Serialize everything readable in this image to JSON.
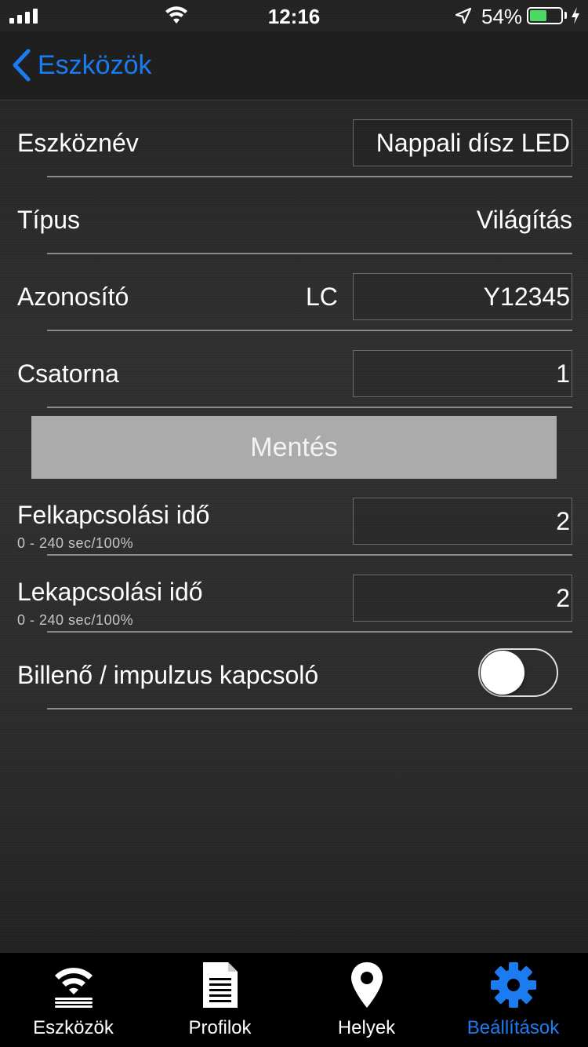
{
  "status_bar": {
    "time": "12:16",
    "battery_percent": "54%",
    "battery_level": 0.54
  },
  "nav": {
    "back_label": "Eszközök"
  },
  "form": {
    "device_name": {
      "label": "Eszköznév",
      "value": "Nappali dísz LED"
    },
    "type": {
      "label": "Típus",
      "value": "Világítás"
    },
    "identifier": {
      "label": "Azonosító",
      "prefix": "LC",
      "value": "Y12345"
    },
    "channel": {
      "label": "Csatorna",
      "value": "1"
    },
    "save_label": "Mentés",
    "ramp_up": {
      "label": "Felkapcsolási idő",
      "hint": "0 - 240 sec/100%",
      "value": "2"
    },
    "ramp_down": {
      "label": "Lekapcsolási idő",
      "hint": "0 - 240 sec/100%",
      "value": "2"
    },
    "switch_mode": {
      "label": "Billenő / impulzus kapcsoló",
      "on": false
    }
  },
  "tabs": [
    {
      "label": "Eszközök",
      "icon": "wifi-devices-icon",
      "active": false
    },
    {
      "label": "Profilok",
      "icon": "document-icon",
      "active": false
    },
    {
      "label": "Helyek",
      "icon": "location-pin-icon",
      "active": false
    },
    {
      "label": "Beállítások",
      "icon": "gear-icon",
      "active": true
    }
  ],
  "colors": {
    "accent": "#1a7cf0",
    "battery_fill": "#4cd964",
    "save_button": "#ababab"
  }
}
